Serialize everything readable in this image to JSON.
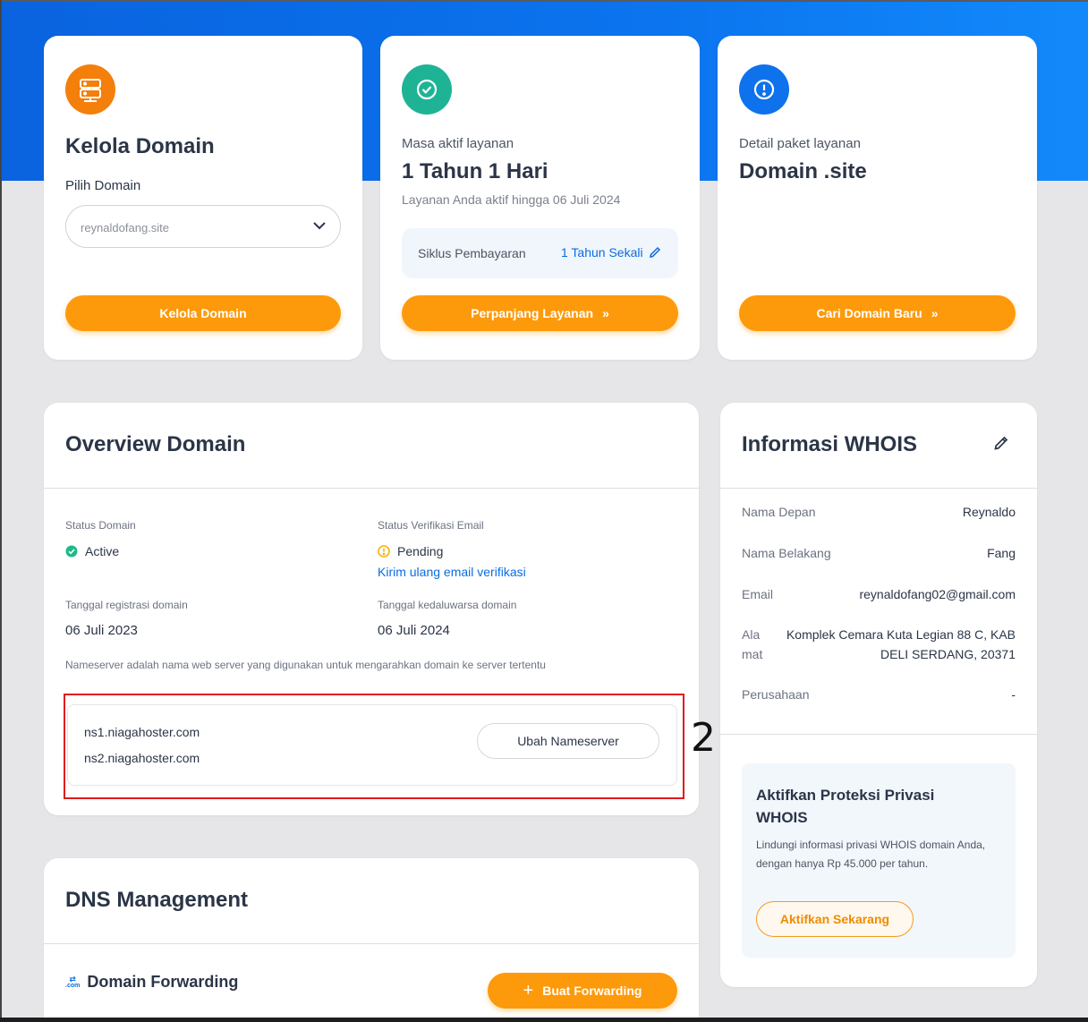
{
  "kelola": {
    "title": "Kelola Domain",
    "select_label": "Pilih Domain",
    "selected_domain": "reynaldofang.site",
    "button": "Kelola Domain"
  },
  "masa_aktif": {
    "label": "Masa aktif layanan",
    "duration": "1 Tahun 1 Hari",
    "note": "Layanan Anda aktif hingga 06 Juli 2024",
    "billing_label": "Siklus Pembayaran",
    "billing_value": "1 Tahun Sekali",
    "button": "Perpanjang Layanan"
  },
  "detail_paket": {
    "label": "Detail paket layanan",
    "name": "Domain .site",
    "button": "Cari Domain Baru"
  },
  "overview": {
    "title": "Overview Domain",
    "status_label": "Status Domain",
    "status_value": "Active",
    "email_label": "Status Verifikasi Email",
    "email_value": "Pending",
    "resend_link": "Kirim ulang email verifikasi",
    "reg_label": "Tanggal registrasi domain",
    "reg_value": "06 Juli 2023",
    "exp_label": "Tanggal kedaluwarsa domain",
    "exp_value": "06 Juli 2024",
    "ns_note": "Nameserver adalah nama web server yang digunakan untuk mengarahkan domain ke server tertentu",
    "ns1": "ns1.niagahoster.com",
    "ns2": "ns2.niagahoster.com",
    "ns_button": "Ubah Nameserver",
    "annotation": "2"
  },
  "whois": {
    "title": "Informasi WHOIS",
    "rows": [
      {
        "label": "Nama Depan",
        "value": "Reynaldo"
      },
      {
        "label": "Nama Belakang",
        "value": "Fang"
      },
      {
        "label": "Email",
        "value": "reynaldofang02@gmail.com"
      },
      {
        "label_line1": "Ala",
        "label_line2": "mat",
        "value_line1": "Komplek Cemara Kuta Legian 88 C, KAB",
        "value_line2": "DELI SERDANG, 20371"
      },
      {
        "label": "Perusahaan",
        "value": "-"
      }
    ],
    "privacy_title_line1": "Aktifkan Proteksi Privasi",
    "privacy_title_line2": "WHOIS",
    "privacy_desc_line1": "Lindungi informasi privasi WHOIS domain Anda,",
    "privacy_desc_line2": "dengan hanya Rp 45.000 per tahun.",
    "privacy_button": "Aktifkan Sekarang"
  },
  "dns": {
    "title": "DNS Management",
    "forwarding_icon_text": ".com",
    "forwarding_title": "Domain Forwarding",
    "forwarding_button": "Buat Forwarding"
  },
  "colors": {
    "hero_blue": "#0b74ee",
    "accent_orange": "#fd9a0b",
    "active_green": "#1fb98a",
    "pending_yellow": "#f6b20e",
    "link_blue": "#0a6ce0",
    "annotation_red": "#e0191c"
  }
}
